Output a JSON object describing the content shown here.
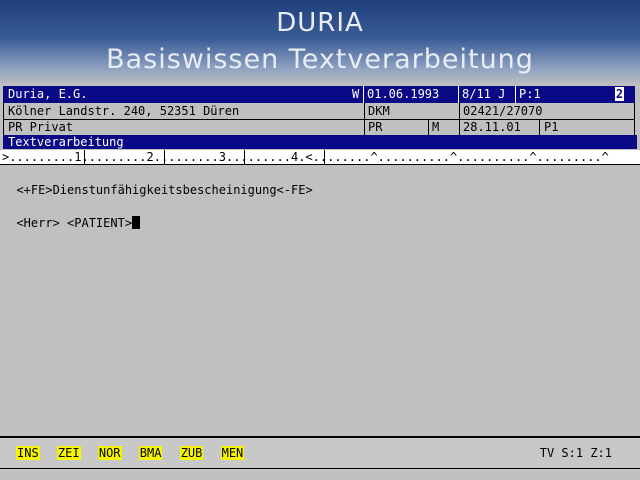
{
  "banner": {
    "title": "DURIA",
    "subtitle": "Basiswissen Textverarbeitung"
  },
  "patient": {
    "name": "Duria, E.G.",
    "sex_flag": "W",
    "birth_date": "01.06.1993",
    "age": "8/11 J",
    "page": "P:1",
    "page_box": "2",
    "address": "Kölner Landstr. 240, 52351 Düren",
    "insurer": "DKM",
    "phone": "02421/27070",
    "status": "PR Privat",
    "status_code": "PR",
    "status_flag": "M",
    "visit_date": "28.11.01",
    "visit_code": "P1"
  },
  "section_title": "Textverarbeitung",
  "ruler": ">.........1.........2.........3.........4.<........^..........^..........^.........^",
  "document": {
    "line1": "<+FE>Dienstunfähigkeitsbescheinigung<-FE>",
    "line2": "<Herr> <PATIENT>"
  },
  "function_keys": [
    "INS",
    "ZEI",
    "NOR",
    "BMA",
    "ZUB",
    "MEN"
  ],
  "statusbar": "TV S:1 Z:1",
  "colors": {
    "header_blue": "#0a0a86",
    "fkey_yellow": "#f5f500",
    "background": "#c0c0c0"
  }
}
